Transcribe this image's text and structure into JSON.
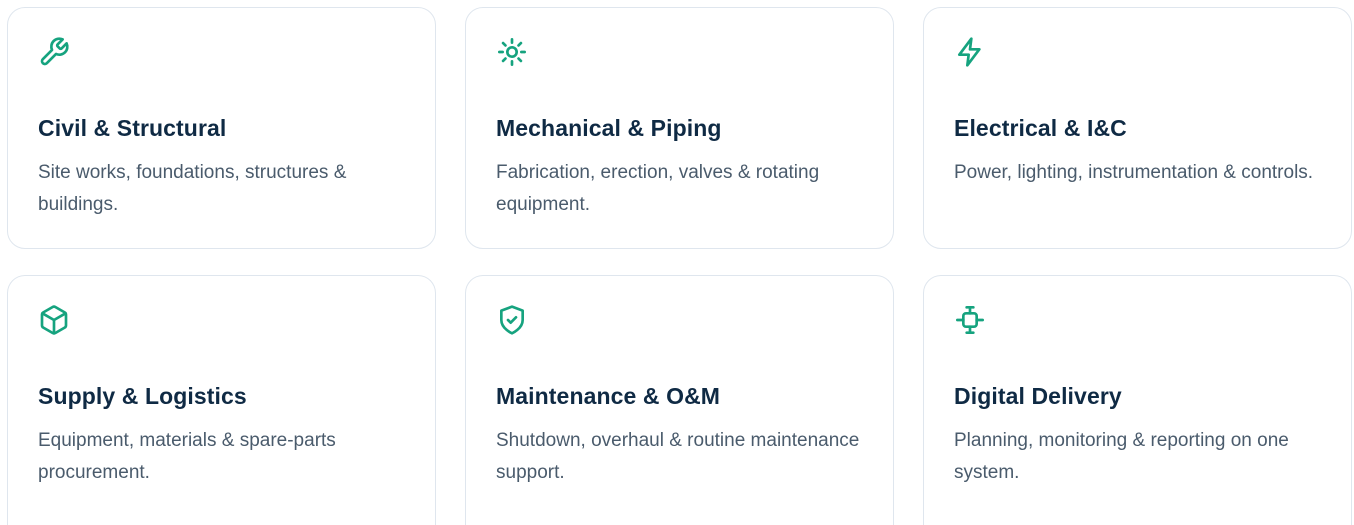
{
  "colors": {
    "accent": "#16a37f",
    "title": "#0f2a44",
    "text": "#4a5b6c",
    "border": "#dfe6ee"
  },
  "cards": [
    {
      "icon": "wrench-icon",
      "title": "Civil & Structural",
      "description": "Site works, foundations, structures & buildings."
    },
    {
      "icon": "sun-icon",
      "title": "Mechanical & Piping",
      "description": "Fabrication, erection, valves & rotating equipment."
    },
    {
      "icon": "lightning-bolt-icon",
      "title": "Electrical & I&C",
      "description": "Power, lighting, instrumentation & controls."
    },
    {
      "icon": "cube-icon",
      "title": "Supply & Logistics",
      "description": "Equipment, materials & spare-parts procurement."
    },
    {
      "icon": "shield-check-icon",
      "title": "Maintenance & O&M",
      "description": "Shutdown, overhaul & routine maintenance support."
    },
    {
      "icon": "cpu-chip-icon",
      "title": "Digital Delivery",
      "description": "Planning, monitoring & reporting on one system."
    }
  ]
}
